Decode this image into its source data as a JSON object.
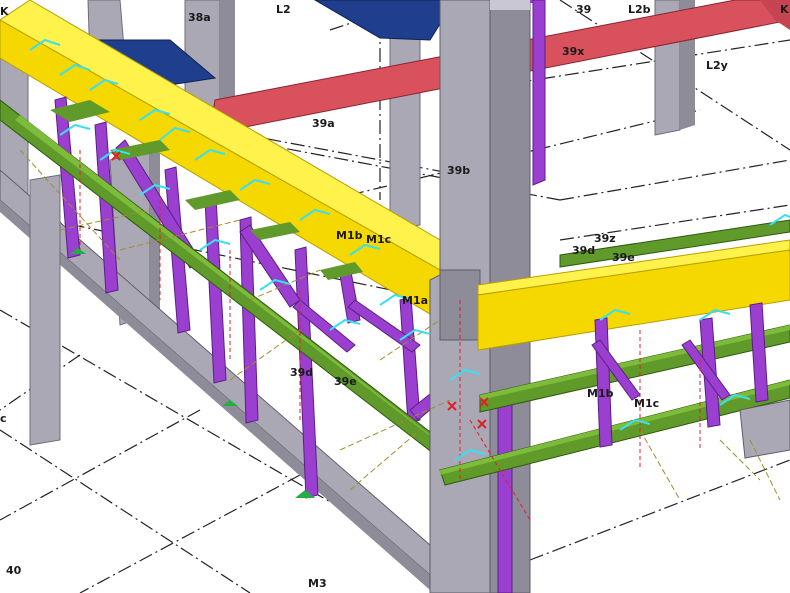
{
  "viewport": {
    "background": "#ffffff",
    "colors": {
      "concrete": "#a9a8b4",
      "concrete_dark": "#8d8c98",
      "concrete_light": "#c9c8d2",
      "yellow_beam": "#f4d800",
      "yellow_beam_top": "#fff24a",
      "green_beam": "#5f9a2a",
      "green_beam_top": "#7dbb3a",
      "purple_member": "#9a3fd0",
      "red_beam": "#d9515d",
      "blue_plate": "#1f3f8e",
      "cyan_marker": "#38e0f0",
      "gridline": "#222222",
      "dim_red": "#e0202a",
      "dim_olive": "#a48c2a"
    },
    "labels": [
      {
        "id": "k-left",
        "text": "K"
      },
      {
        "id": "38a",
        "text": "38a"
      },
      {
        "id": "L2",
        "text": "L2"
      },
      {
        "id": "39-top",
        "text": "39"
      },
      {
        "id": "L2b",
        "text": "L2b"
      },
      {
        "id": "k-right",
        "text": "K"
      },
      {
        "id": "39x",
        "text": "39x"
      },
      {
        "id": "L2y",
        "text": "L2y"
      },
      {
        "id": "39a",
        "text": "39a"
      },
      {
        "id": "39b",
        "text": "39b"
      },
      {
        "id": "39z",
        "text": "39z"
      },
      {
        "id": "39d-right",
        "text": "39d"
      },
      {
        "id": "39e-right",
        "text": "39e"
      },
      {
        "id": "M1b-left",
        "text": "M1b"
      },
      {
        "id": "M1c-left",
        "text": "M1c"
      },
      {
        "id": "M1a",
        "text": "M1a"
      },
      {
        "id": "39d-left",
        "text": "39d"
      },
      {
        "id": "39e-left",
        "text": "39e"
      },
      {
        "id": "M1b-right",
        "text": "M1b"
      },
      {
        "id": "M1c-right",
        "text": "M1c"
      },
      {
        "id": "c-left",
        "text": "c"
      },
      {
        "id": "40",
        "text": "40"
      },
      {
        "id": "M3",
        "text": "M3"
      }
    ]
  }
}
